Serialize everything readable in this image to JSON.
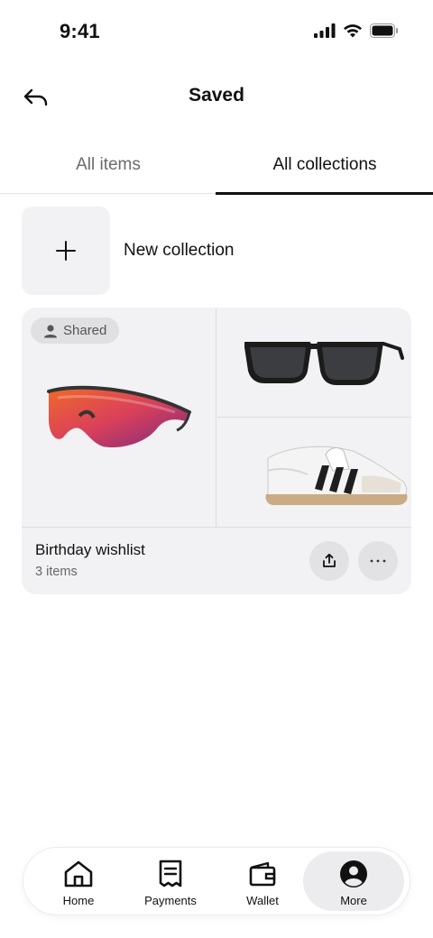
{
  "status_bar": {
    "time": "9:41"
  },
  "header": {
    "title": "Saved"
  },
  "tabs": [
    {
      "label": "All items",
      "active": false
    },
    {
      "label": "All collections",
      "active": true
    }
  ],
  "new_collection": {
    "label": "New collection"
  },
  "collections": [
    {
      "title": "Birthday wishlist",
      "count": "3 items",
      "badge": "Shared",
      "images": [
        "sport-sunglasses",
        "wayfarer-sunglasses",
        "sneaker"
      ]
    }
  ],
  "bottom_nav": [
    {
      "label": "Home",
      "icon": "home-icon",
      "active": false
    },
    {
      "label": "Payments",
      "icon": "receipt-icon",
      "active": false
    },
    {
      "label": "Wallet",
      "icon": "wallet-icon",
      "active": false
    },
    {
      "label": "More",
      "icon": "user-circle-icon",
      "active": true
    }
  ],
  "colors": {
    "accent": "#111111",
    "surface": "#f2f2f4",
    "lens_orange": "#e8542a",
    "lens_purple": "#8a2a6e"
  }
}
